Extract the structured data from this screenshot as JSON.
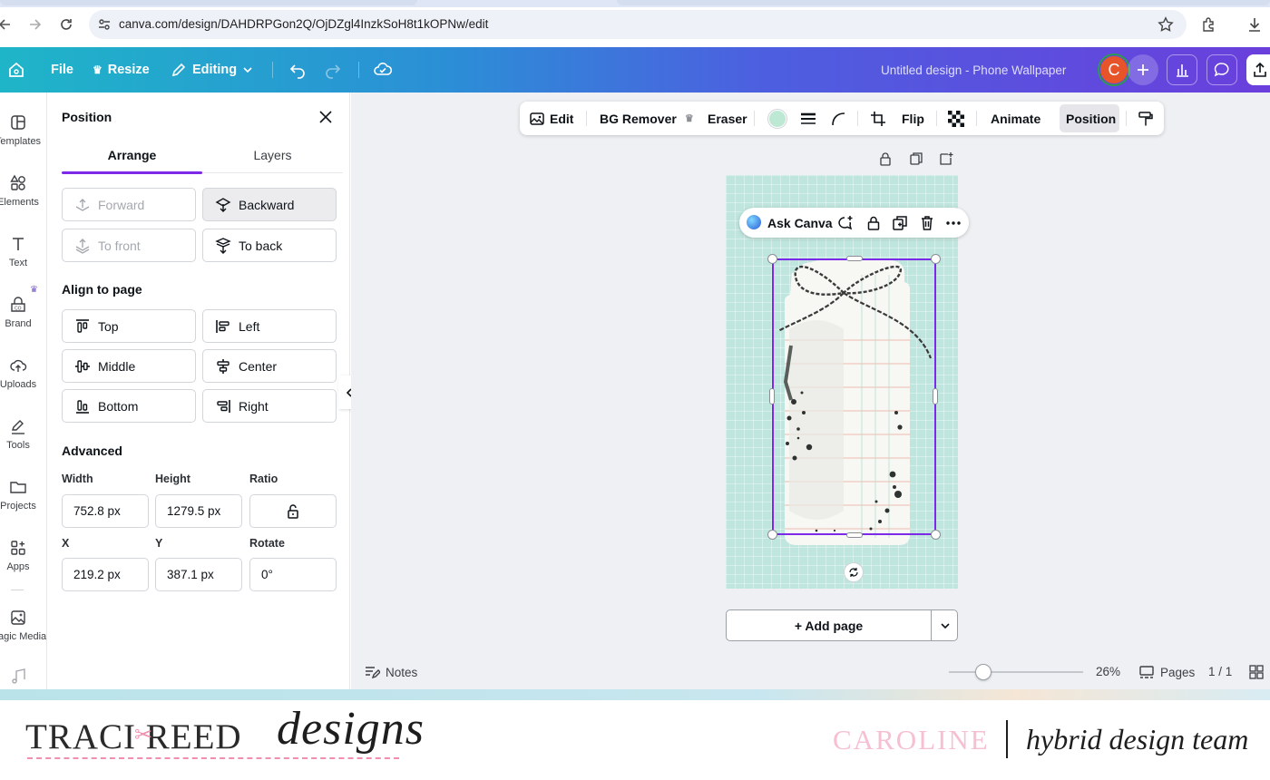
{
  "browser": {
    "url": "canva.com/design/DAHDRPGon2Q/OjDZgl4InzkSoH8t1kOPNw/edit"
  },
  "topbar": {
    "file": "File",
    "resize": "Resize",
    "editing": "Editing",
    "design_title": "Untitled design - Phone Wallpaper",
    "avatar_letter": "C",
    "avatar_color": "#e8542a"
  },
  "rail": {
    "items": [
      "Templates",
      "Elements",
      "Text",
      "Brand",
      "Uploads",
      "Tools",
      "Projects",
      "Apps",
      "Magic Media"
    ]
  },
  "panel": {
    "title": "Position",
    "tabs": [
      "Arrange",
      "Layers"
    ],
    "arrange": {
      "forward": "Forward",
      "backward": "Backward",
      "to_front": "To front",
      "to_back": "To back"
    },
    "align_heading": "Align to page",
    "align": {
      "top": "Top",
      "left": "Left",
      "middle": "Middle",
      "center": "Center",
      "bottom": "Bottom",
      "right": "Right"
    },
    "advanced_heading": "Advanced",
    "labels": {
      "width": "Width",
      "height": "Height",
      "ratio": "Ratio",
      "x": "X",
      "y": "Y",
      "rotate": "Rotate"
    },
    "values": {
      "width": "752.8 px",
      "height": "1279.5 px",
      "x": "219.2 px",
      "y": "387.1 px",
      "rotate": "0°"
    }
  },
  "context_toolbar": {
    "edit": "Edit",
    "bg_remover": "BG Remover",
    "eraser": "Eraser",
    "flip": "Flip",
    "animate": "Animate",
    "position": "Position",
    "swatch_color": "#bde8d4"
  },
  "ask_canva": "Ask Canva",
  "add_page": "+ Add page",
  "footer": {
    "notes": "Notes",
    "zoom": "26%",
    "pages_label": "Pages",
    "pages_count": "1 / 1",
    "zoom_level": 0.26
  },
  "branding": {
    "brand_name": "TRACI REED",
    "brand_script": "designs",
    "name": "CAROLINE",
    "team": "hybrid design team"
  },
  "colors": {
    "accent_purple": "#7d2ae8",
    "page_bg": "#bfe6de"
  }
}
